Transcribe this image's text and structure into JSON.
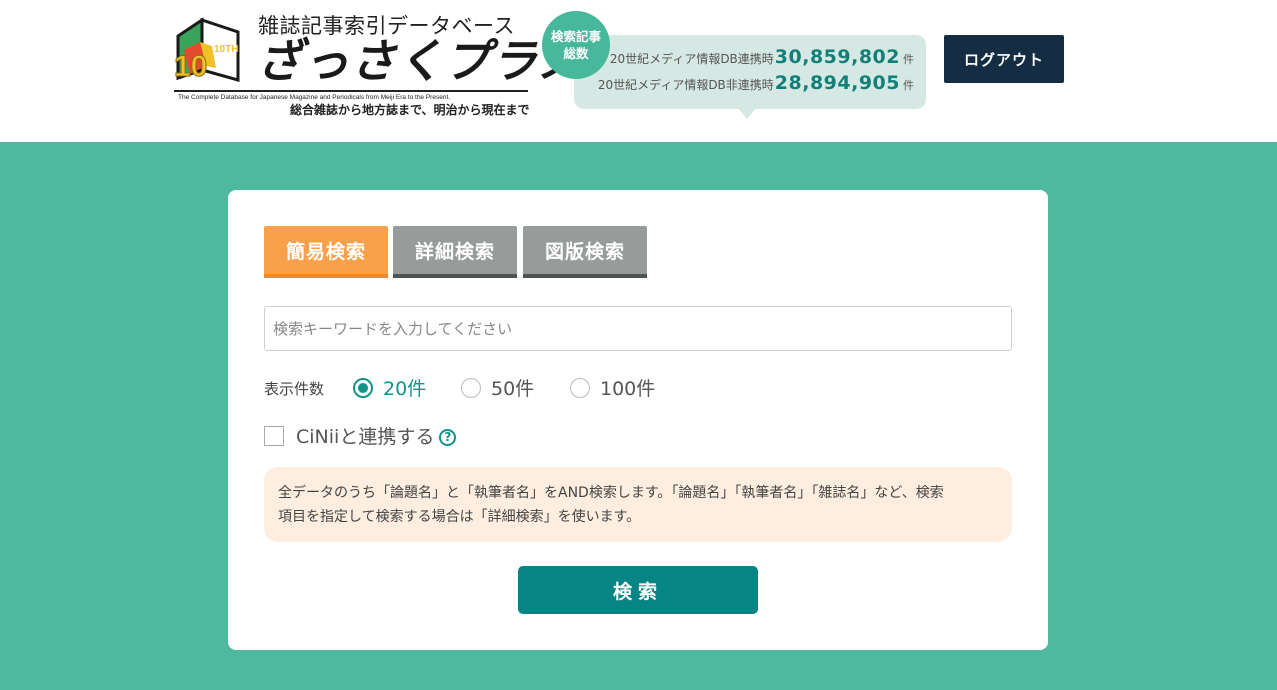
{
  "header": {
    "logo": {
      "small_title": "雑誌記事索引データベース",
      "main_title": "ざっさくプラス",
      "english": "The Complete Database for Japanese Magazine and Periodicals from Meiji Era to the Present.",
      "tagline": "総合雑誌から地方誌まで、明治から現在まで",
      "badge": "10TH"
    },
    "stats": {
      "circle_line1": "検索記事",
      "circle_line2": "総数",
      "rows": [
        {
          "label": "20世紀メディア情報DB連携時",
          "value": "30,859,802",
          "unit": "件"
        },
        {
          "label": "20世紀メディア情報DB非連携時",
          "value": "28,894,905",
          "unit": "件"
        }
      ]
    },
    "logout_label": "ログアウト"
  },
  "search": {
    "tabs": [
      {
        "label": "簡易検索",
        "active": true
      },
      {
        "label": "詳細検索",
        "active": false
      },
      {
        "label": "図版検索",
        "active": false
      }
    ],
    "placeholder": "検索キーワードを入力してください",
    "value": "",
    "count_label": "表示件数",
    "count_options": [
      {
        "label": "20件",
        "checked": true
      },
      {
        "label": "50件",
        "checked": false
      },
      {
        "label": "100件",
        "checked": false
      }
    ],
    "cinii_label": "CiNiiと連携する",
    "cinii_checked": false,
    "help_glyph": "?",
    "notice_line1": "全データのうち「論題名」と「執筆者名」をAND検索します。「論題名」「執筆者名」「雑誌名」など、検索",
    "notice_line2": "項目を指定して検索する場合は「詳細検索」を使います。",
    "submit_label": "検索"
  },
  "colors": {
    "page_bg": "#4fb9a0",
    "accent_teal": "#078484",
    "tab_active": "#f9a04a",
    "tab_inactive": "#979c9a",
    "logout_bg": "#142d42"
  }
}
